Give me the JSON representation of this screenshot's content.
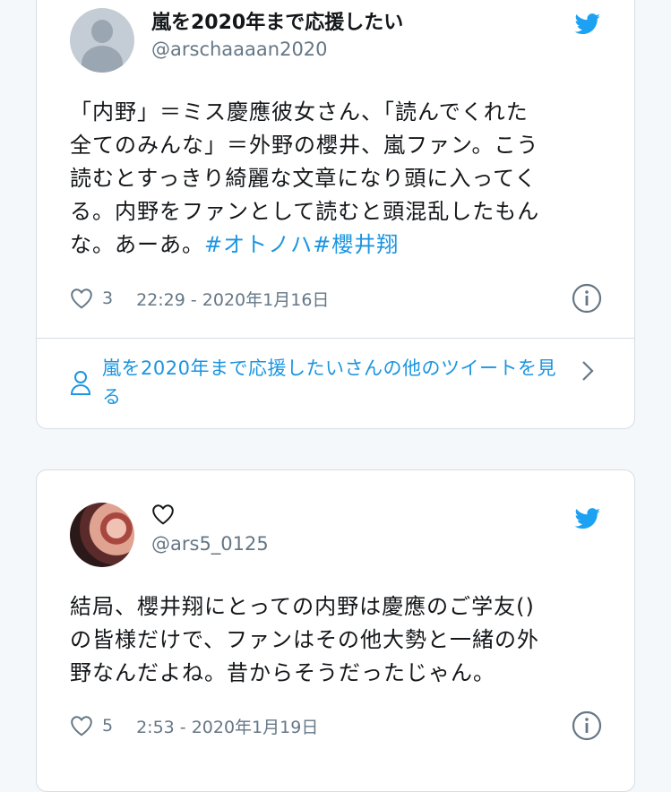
{
  "tweets": [
    {
      "author_name": "嵐を2020年まで応援したい",
      "handle": "@arschaaaan2020",
      "text_lines": [
        "「内野」＝ミス慶應彼女さん、「読んでくれた",
        "全てのみんな」＝外野の櫻井、嵐ファン。こう",
        "読むとすっきり綺麗な文章になり頭に入ってく",
        "る。内野をファンとして読むと頭混乱したもん"
      ],
      "last_line_text": "な。あーあ。",
      "hashtags": [
        "#オトノハ",
        "#櫻井翔"
      ],
      "likes": "3",
      "timestamp": "22:29 - 2020年1月16日",
      "more_tweets_link": "嵐を2020年まで応援したいさんの他のツイートを見る"
    },
    {
      "author_name": "",
      "handle": "@ars5_0125",
      "text_lines": [
        "結局、櫻井翔にとっての内野は慶應のご学友()",
        "の皆様だけで、ファンはその他大勢と一緒の外",
        "野なんだよね。昔からそうだったじゃん。"
      ],
      "likes": "5",
      "timestamp": "2:53 - 2020年1月19日"
    }
  ],
  "icons": [
    "twitter-bird-icon",
    "heart-icon",
    "info-icon",
    "person-icon",
    "chevron-right-icon",
    "default-avatar-icon"
  ],
  "colors": {
    "accent": "#1b95e0",
    "text": "#14171a",
    "muted": "#657786",
    "border": "#d6dde3"
  }
}
